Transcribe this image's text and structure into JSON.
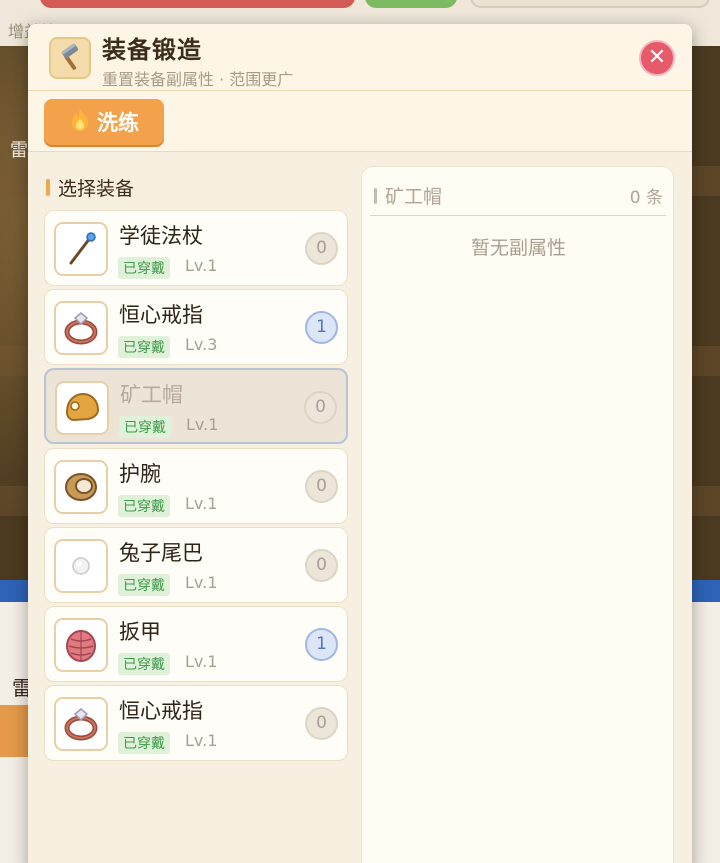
{
  "background": {
    "top_text": "增益效果 · 正",
    "side_text": "雷",
    "lower_label": "雷"
  },
  "modal": {
    "title": "装备锻造",
    "subtitle": "重置装备副属性 · 范围更广",
    "close_icon": "close-icon",
    "tab": {
      "icon": "fire-icon",
      "label": "洗练"
    }
  },
  "equip_list": {
    "title": "选择装备",
    "items": [
      {
        "name": "学徒法杖",
        "tag": "已穿戴",
        "level": "Lv.1",
        "count": "0",
        "icon": "staff-icon",
        "selected": false
      },
      {
        "name": "恒心戒指",
        "tag": "已穿戴",
        "level": "Lv.3",
        "count": "1",
        "icon": "ring-icon",
        "selected": false
      },
      {
        "name": "矿工帽",
        "tag": "已穿戴",
        "level": "Lv.1",
        "count": "0",
        "icon": "helmet-icon",
        "selected": true
      },
      {
        "name": "护腕",
        "tag": "已穿戴",
        "level": "Lv.1",
        "count": "0",
        "icon": "bracer-icon",
        "selected": false
      },
      {
        "name": "兔子尾巴",
        "tag": "已穿戴",
        "level": "Lv.1",
        "count": "0",
        "icon": "rabbit-tail-icon",
        "selected": false
      },
      {
        "name": "扳甲",
        "tag": "已穿戴",
        "level": "Lv.1",
        "count": "1",
        "icon": "armor-icon",
        "selected": false
      },
      {
        "name": "恒心戒指",
        "tag": "已穿戴",
        "level": "Lv.1",
        "count": "0",
        "icon": "ring-icon",
        "selected": false
      }
    ]
  },
  "detail": {
    "title": "矿工帽",
    "count": "0 条",
    "empty_text": "暂无副属性"
  }
}
